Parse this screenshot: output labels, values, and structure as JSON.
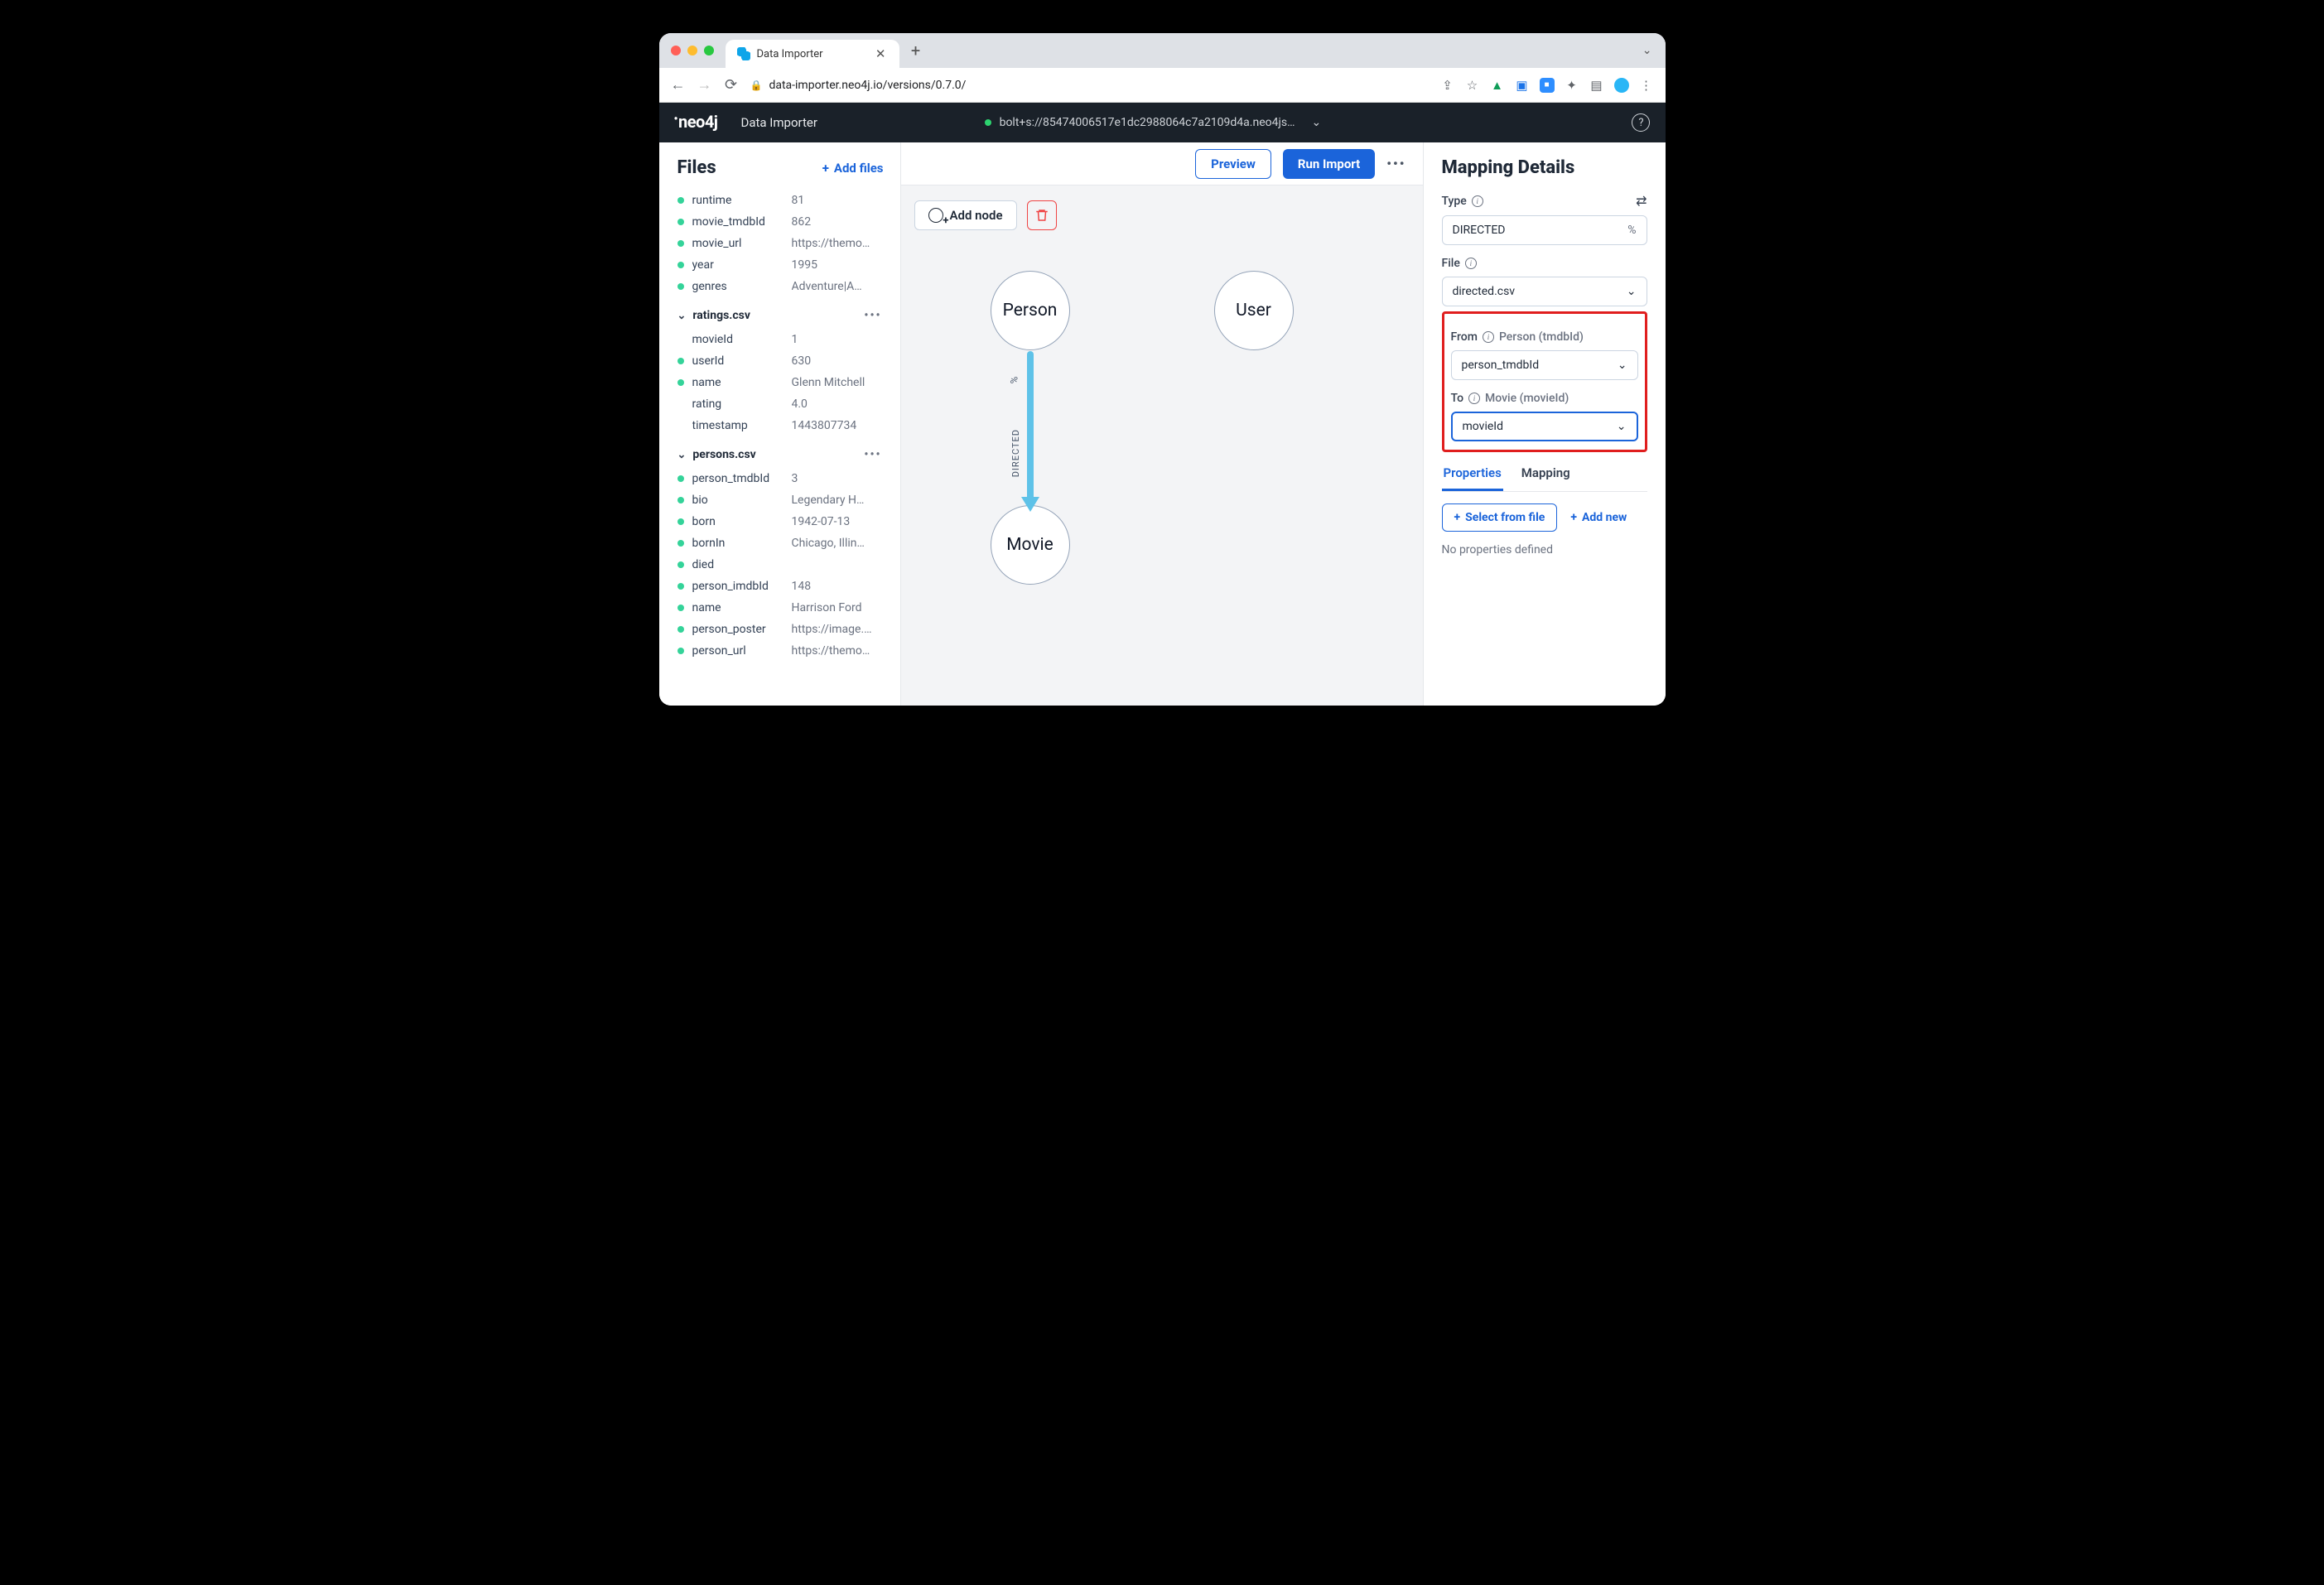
{
  "browser": {
    "tab_title": "Data Importer",
    "url": "data-importer.neo4j.io/versions/0.7.0/"
  },
  "app": {
    "logo_text": "neo4j",
    "title": "Data Importer",
    "connection": "bolt+s://85474006517e1dc2988064c7a2109d4a.neo4js…"
  },
  "files": {
    "heading": "Files",
    "add_label": "Add files",
    "top_rows": [
      {
        "dot": true,
        "key": "runtime",
        "val": "81"
      },
      {
        "dot": true,
        "key": "movie_tmdbId",
        "val": "862"
      },
      {
        "dot": true,
        "key": "movie_url",
        "val": "https://themo…"
      },
      {
        "dot": true,
        "key": "year",
        "val": "1995"
      },
      {
        "dot": true,
        "key": "genres",
        "val": "Adventure|A…"
      }
    ],
    "groups": [
      {
        "name": "ratings.csv",
        "rows": [
          {
            "dot": false,
            "key": "movieId",
            "val": "1"
          },
          {
            "dot": true,
            "key": "userId",
            "val": "630"
          },
          {
            "dot": true,
            "key": "name",
            "val": "Glenn Mitchell"
          },
          {
            "dot": false,
            "key": "rating",
            "val": "4.0"
          },
          {
            "dot": false,
            "key": "timestamp",
            "val": "1443807734"
          }
        ]
      },
      {
        "name": "persons.csv",
        "rows": [
          {
            "dot": true,
            "key": "person_tmdbId",
            "val": "3"
          },
          {
            "dot": true,
            "key": "bio",
            "val": "Legendary H…"
          },
          {
            "dot": true,
            "key": "born",
            "val": "1942-07-13"
          },
          {
            "dot": true,
            "key": "bornIn",
            "val": "Chicago, Illin…"
          },
          {
            "dot": true,
            "key": "died",
            "val": ""
          },
          {
            "dot": true,
            "key": "person_imdbId",
            "val": "148"
          },
          {
            "dot": true,
            "key": "name",
            "val": "Harrison Ford"
          },
          {
            "dot": true,
            "key": "person_poster",
            "val": "https://image.…"
          },
          {
            "dot": true,
            "key": "person_url",
            "val": "https://themo…"
          }
        ]
      }
    ]
  },
  "canvas": {
    "preview_label": "Preview",
    "run_label": "Run Import",
    "add_node_label": "Add node",
    "nodes": {
      "person": "Person",
      "movie": "Movie",
      "user": "User"
    },
    "edge": {
      "label": "DIRECTED",
      "pct": "%"
    }
  },
  "details": {
    "heading": "Mapping Details",
    "type_label": "Type",
    "type_value": "DIRECTED",
    "type_pct": "%",
    "file_label": "File",
    "file_value": "directed.csv",
    "from_label": "From",
    "from_hint": "Person (tmdbId)",
    "from_value": "person_tmdbId",
    "to_label": "To",
    "to_hint": "Movie (movieId)",
    "to_value": "movieId",
    "tabs": {
      "properties": "Properties",
      "mapping": "Mapping"
    },
    "select_from_file": "Select from file",
    "add_new": "Add new",
    "empty": "No properties defined"
  }
}
